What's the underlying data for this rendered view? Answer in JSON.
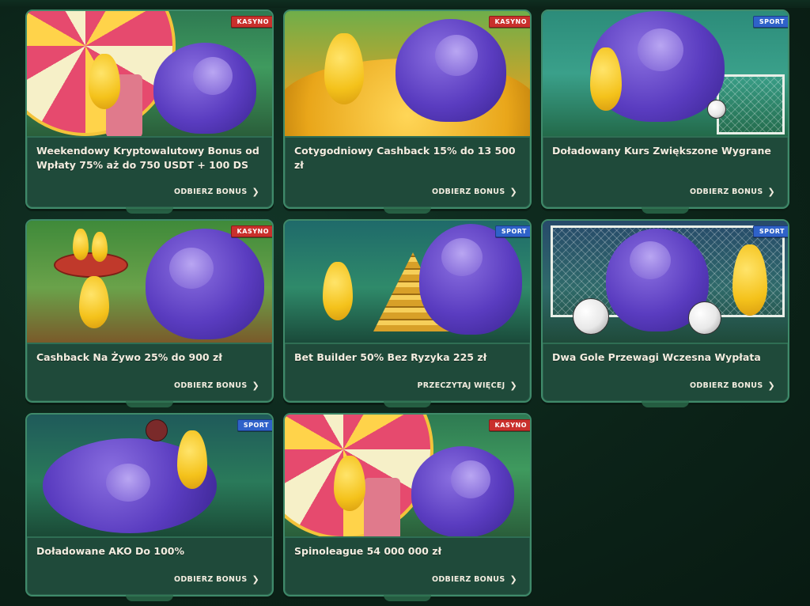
{
  "colors": {
    "page_bg": "#0c2419",
    "card_bg": "#1f4a3a",
    "card_border": "#3f8a6a",
    "badge_kasyno": "#c9302c",
    "badge_sport": "#2f62c9",
    "text": "#f3ede0"
  },
  "icons": {
    "link_chevron": "chevron-right-icon"
  },
  "cards": [
    {
      "badge": "KASYNO",
      "badge_type": "kasyno",
      "title": "Weekendowy Kryptowalutowy Bonus od Wpłaty 75% aż do 750 USDT + 100 DS",
      "link": "ODBIERZ BONUS",
      "art": "wheel"
    },
    {
      "badge": "KASYNO",
      "badge_type": "kasyno",
      "title": "Cotygodniowy Cashback 15% do 13 500 zł",
      "link": "ODBIERZ BONUS",
      "art": "coins"
    },
    {
      "badge": "SPORT",
      "badge_type": "sport",
      "title": "Doładowany Kurs Zwiększone Wygrane",
      "link": "ODBIERZ BONUS",
      "art": "soccer"
    },
    {
      "badge": "KASYNO",
      "badge_type": "kasyno",
      "title": "Cashback Na Żywo 25% do 900 zł",
      "link": "ODBIERZ BONUS",
      "art": "tray"
    },
    {
      "badge": "SPORT",
      "badge_type": "sport",
      "title": "Bet Builder 50% Bez Ryzyka 225 zł",
      "link": "PRZECZYTAJ WIĘCEJ",
      "art": "gold"
    },
    {
      "badge": "SPORT",
      "badge_type": "sport",
      "title": "Dwa Gole Przewagi Wczesna Wypłata",
      "link": "ODBIERZ BONUS",
      "art": "goal"
    },
    {
      "badge": "SPORT",
      "badge_type": "sport",
      "title": "Doładowane AKO Do 100%",
      "link": "ODBIERZ BONUS",
      "art": "basket"
    },
    {
      "badge": "KASYNO",
      "badge_type": "kasyno",
      "title": "Spinoleague 54 000 000 zł",
      "link": "ODBIERZ BONUS",
      "art": "wheel"
    }
  ]
}
